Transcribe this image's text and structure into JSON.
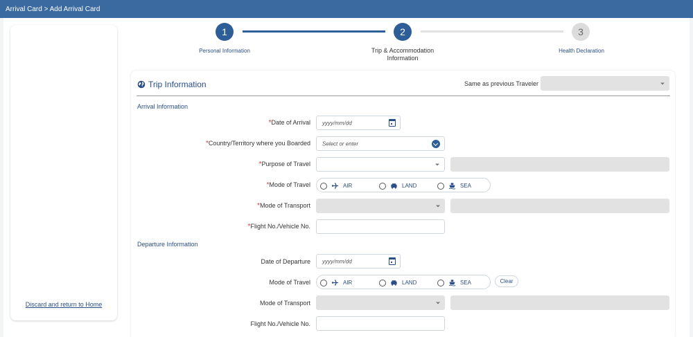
{
  "header": {
    "breadcrumb": "Arrival Card > Add Arrival Card"
  },
  "sidebar": {
    "discard_link": "Discard and return to Home"
  },
  "stepper": {
    "steps": [
      {
        "number": "1",
        "label": "Personal Information",
        "state": "completed"
      },
      {
        "number": "2",
        "label": "Trip & Accommodation Information",
        "state": "current"
      },
      {
        "number": "3",
        "label": "Health Declaration",
        "state": "upcoming"
      }
    ]
  },
  "trip": {
    "title": "Trip Information",
    "title_icon": "globe-icon",
    "same_as_previous_label": "Same as previous Traveler",
    "same_as_previous_value": ""
  },
  "arrival": {
    "section_title": "Arrival Information",
    "date_label": "Date of Arrival",
    "date_placeholder": "yyyy/mm/dd",
    "country_label": "Country/Territory where you Boarded",
    "country_placeholder": "Select or enter",
    "purpose_label": "Purpose of Travel",
    "purpose_value": "",
    "mode_label": "Mode of Travel",
    "mode_options": [
      "AIR",
      "LAND",
      "SEA"
    ],
    "transport_label": "Mode of Transport",
    "flight_label": "Flight No./Vehicle No."
  },
  "departure": {
    "section_title": "Departure Information",
    "date_label": "Date of Departure",
    "date_placeholder": "yyyy/mm/dd",
    "mode_label": "Mode of Travel",
    "mode_options": [
      "AIR",
      "LAND",
      "SEA"
    ],
    "clear_label": "Clear",
    "transport_label": "Mode of Transport",
    "flight_label": "Flight No./Vehicle No."
  },
  "required_marker": "*",
  "colors": {
    "primary": "#2d5e97",
    "header": "#3a6aa0",
    "required": "#d23a3a"
  }
}
